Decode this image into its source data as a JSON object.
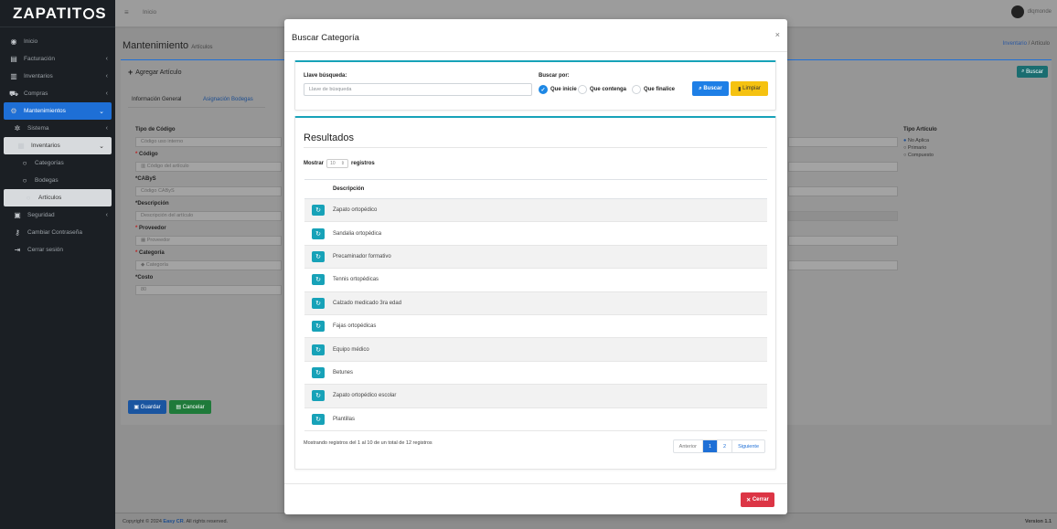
{
  "brand": {
    "name_pre": "ZAPATIT",
    "name_post": "S"
  },
  "sidebar": {
    "items": [
      {
        "icon": "◉",
        "label": "Inicio"
      },
      {
        "icon": "▤",
        "label": "Facturación",
        "chev": "‹"
      },
      {
        "icon": "▥",
        "label": "Inventarios",
        "chev": "‹"
      },
      {
        "icon": "⛟",
        "label": "Compras",
        "chev": "‹"
      },
      {
        "icon": "⚙",
        "label": "Mantenimientos",
        "chev": "⌄"
      },
      {
        "icon": "✲",
        "label": "Sistema",
        "chev": "‹"
      },
      {
        "icon": "▦",
        "label": "Inventarios",
        "chev": "⌄"
      },
      {
        "icon": "○",
        "label": "Categorías"
      },
      {
        "icon": "○",
        "label": "Bodegas"
      },
      {
        "icon": "○",
        "label": "Artículos"
      },
      {
        "icon": "▣",
        "label": "Seguridad",
        "chev": "‹"
      },
      {
        "icon": "⚷",
        "label": "Cambiar Contraseña"
      },
      {
        "icon": "⇥",
        "label": "Cerrar sesión"
      }
    ]
  },
  "topbar": {
    "menu": "≡",
    "home": "Inicio",
    "user": "dlqmonde"
  },
  "page": {
    "title": "Mantenimiento",
    "subtitle": "Artículos",
    "breadcrumb_link": "Inventario",
    "breadcrumb_sep": "/",
    "breadcrumb_current": "Artículo",
    "add_button": "Agregar Artículo",
    "search_button": "Buscar",
    "tab_general": "Información General",
    "tab_bodegas": "Asignación Bodegas",
    "tipo_codigo_label": "Tipo de Código",
    "tipo_codigo_value": "Código uso interno",
    "codigo_label": "Código",
    "codigo_placeholder": "Código del artículo",
    "cabys_label": "*CAByS",
    "cabys_placeholder": "Código CAByS",
    "descripcion_label": "*Descripción",
    "descripcion_placeholder": "Descripción del artículo",
    "proveedor_label": "Proveedor",
    "proveedor_placeholder": "Proveedor",
    "categoria_label": "Categoría",
    "categoria_placeholder": "Categoría",
    "costo_label": "*Costo",
    "costo_value": "80",
    "tipo_articulo_label": "Tipo Artículo",
    "tipo_articulo_options": [
      "No Aplica",
      "Primario",
      "Compuesto"
    ],
    "save_button": "Guardar",
    "cancel_button": "Cancelar"
  },
  "footer": {
    "copy_pre": "Copyright © 2024",
    "company": "Easy CR",
    "copy_post": ". All rights reserved.",
    "version": "Version 1.1"
  },
  "modal": {
    "title": "Buscar Categoría",
    "close": "×",
    "search_key_label": "Llave búsqueda:",
    "search_key_placeholder": "Llave de búsqueda",
    "search_by_label": "Buscar por:",
    "opt_starts": "Que inicie",
    "opt_contains": "Que contenga",
    "opt_ends": "Que finalice",
    "search_button": "Buscar",
    "clear_button": "Limpiar",
    "results_title": "Resultados",
    "show_label": "Mostrar",
    "show_value": "10",
    "records_label": "registros",
    "col_desc": "Descripción",
    "rows": [
      "Zapato ortopédico",
      "Sandalia ortopédica",
      "Precaminador formativo",
      "Tennis ortopédicas",
      "Calzado medicado 3ra edad",
      "Fajas ortopédicas",
      "Equipo médico",
      "Betunes",
      "Zapato ortopédico escolar",
      "Plantillas"
    ],
    "info": "Mostrando registros del 1 al 10 de un total de 12 registros",
    "prev": "Anterior",
    "page1": "1",
    "page2": "2",
    "next": "Siguiente",
    "close_button": "Cerrar"
  }
}
